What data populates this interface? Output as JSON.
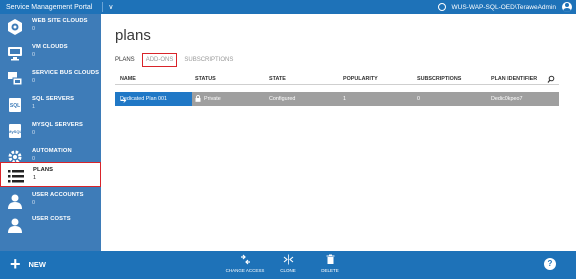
{
  "topbar": {
    "title": "Service Management Portal",
    "user": "WUS-WAP-SQL-OED\\TeraweAdmin"
  },
  "sidebar": {
    "items": [
      {
        "label": "WEB SITE CLOUDS",
        "count": "0",
        "icon": "web-site-clouds-icon"
      },
      {
        "label": "VM CLOUDS",
        "count": "0",
        "icon": "vm-clouds-icon"
      },
      {
        "label": "SERVICE BUS CLOUDS",
        "count": "0",
        "icon": "service-bus-clouds-icon"
      },
      {
        "label": "SQL SERVERS",
        "count": "1",
        "icon": "sql-servers-icon"
      },
      {
        "label": "MYSQL SERVERS",
        "count": "0",
        "icon": "mysql-servers-icon"
      },
      {
        "label": "AUTOMATION",
        "count": "0",
        "icon": "automation-icon"
      },
      {
        "label": "PLANS",
        "count": "1",
        "icon": "plans-icon"
      },
      {
        "label": "USER ACCOUNTS",
        "count": "0",
        "icon": "user-accounts-icon"
      },
      {
        "label": "USER COSTS",
        "count": "",
        "icon": "user-costs-icon"
      }
    ]
  },
  "main": {
    "title": "plans",
    "tabs": [
      "PLANS",
      "ADD-ONS",
      "SUBSCRIPTIONS"
    ],
    "columns": [
      "NAME",
      "STATUS",
      "STATE",
      "POPULARITY",
      "SUBSCRIPTIONS",
      "PLAN IDENTIFIER"
    ],
    "rows": [
      {
        "name": "Dedicated Plan 001",
        "status": "Private",
        "state": "Configured",
        "popularity": "1",
        "subscriptions": "0",
        "plan_identifier": "Dedic0kpeo7"
      }
    ]
  },
  "bottombar": {
    "new_label": "NEW",
    "commands": [
      {
        "label": "CHANGE ACCESS",
        "icon": "change-access-icon"
      },
      {
        "label": "CLONE",
        "icon": "clone-icon"
      },
      {
        "label": "DELETE",
        "icon": "delete-icon"
      }
    ],
    "help": "?"
  },
  "colors": {
    "accent": "#1e72b8",
    "sidebar": "#3e7cb8",
    "highlight": "#d9242a",
    "row": "#9f9f9f",
    "row_name": "#2078c6"
  }
}
